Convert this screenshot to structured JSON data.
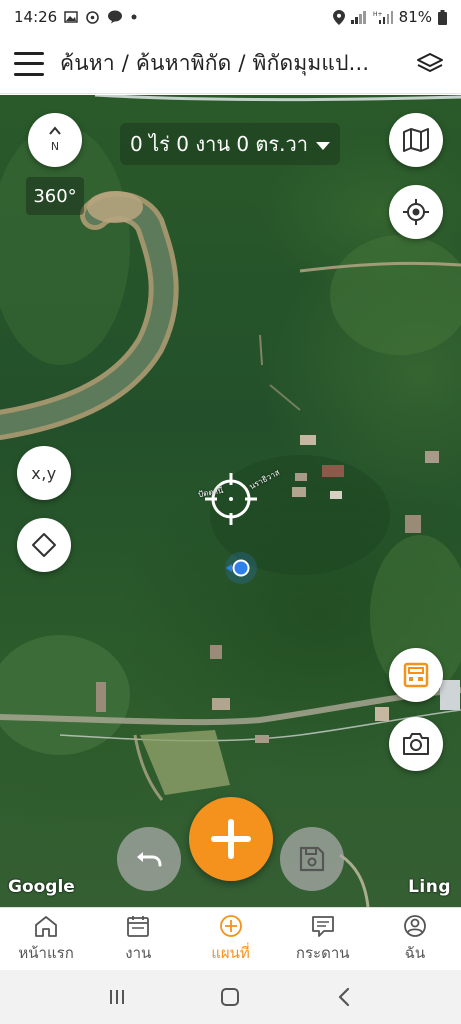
{
  "status_bar": {
    "time": "14:26",
    "battery": "81%"
  },
  "header": {
    "breadcrumb": "ค้นหา / ค้นหาพิกัด / พิกัดมุมแป..."
  },
  "map": {
    "area_readout": "0 ไร่ 0 งาน 0 ตร.วา",
    "compass_letter": "N",
    "view_360_label": "360°",
    "xy_button_label": "x,y",
    "attribution_left": "Google",
    "attribution_right": "Ling",
    "place_label_1": "ปัตตานี",
    "place_label_2": "นราธิวาส"
  },
  "bottom_nav": {
    "items": [
      {
        "label": "หน้าแรก",
        "icon": "home-icon"
      },
      {
        "label": "งาน",
        "icon": "calendar-icon"
      },
      {
        "label": "แผนที่",
        "icon": "map-add-icon"
      },
      {
        "label": "กระดาน",
        "icon": "board-icon"
      },
      {
        "label": "ฉัน",
        "icon": "profile-icon"
      }
    ],
    "active_index": 2
  },
  "colors": {
    "accent": "#f5921e",
    "location_dot": "#2f80ed"
  }
}
